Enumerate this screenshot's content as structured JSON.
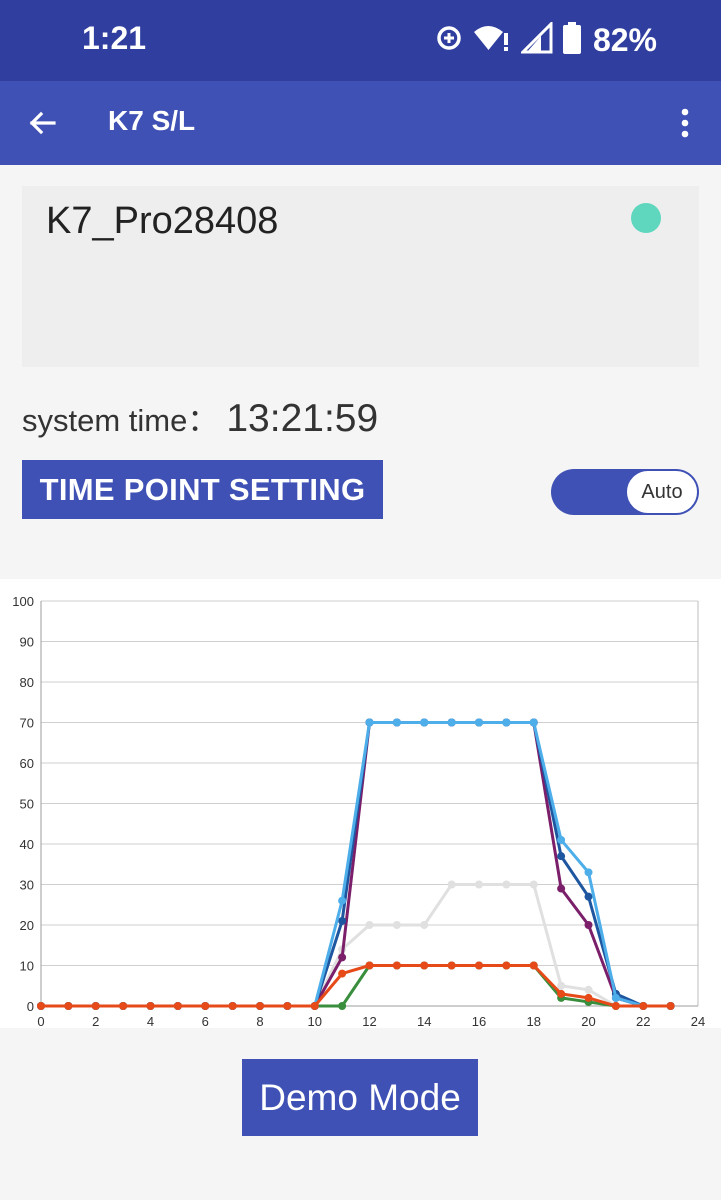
{
  "status_bar": {
    "time": "1:21",
    "battery": "82%",
    "icons": [
      "data-saver-icon",
      "wifi-alert-icon",
      "cell-signal-icon",
      "battery-icon"
    ]
  },
  "app_bar": {
    "title": "K7 S/L",
    "back_icon": "arrow-back-icon",
    "menu_icon": "more-vert-icon"
  },
  "device": {
    "name": "K7_Pro28408",
    "status_color": "#5fd7bf"
  },
  "system_time": {
    "label": "system time：",
    "value": "13:21:59"
  },
  "time_point_button": "TIME POINT SETTING",
  "mode_toggle": {
    "label": "Auto",
    "on": true
  },
  "demo_button": "Demo Mode",
  "colors": {
    "primary": "#3f51b5",
    "primary_dark": "#303f9f",
    "accent": "#5fd7bf"
  },
  "chart_data": {
    "type": "line",
    "x": [
      0,
      1,
      2,
      3,
      4,
      5,
      6,
      7,
      8,
      9,
      10,
      11,
      12,
      13,
      14,
      15,
      16,
      17,
      18,
      19,
      20,
      21,
      22,
      23,
      24
    ],
    "x_ticks": [
      0,
      2,
      4,
      6,
      8,
      10,
      12,
      14,
      16,
      18,
      20,
      22,
      24
    ],
    "y_ticks": [
      0,
      10,
      20,
      30,
      40,
      50,
      60,
      70,
      80,
      90,
      100
    ],
    "xlim": [
      0,
      24
    ],
    "ylim": [
      0,
      100
    ],
    "grid": true,
    "series": [
      {
        "color": "#e0e0e0",
        "values": [
          0,
          0,
          0,
          0,
          0,
          0,
          0,
          0,
          0,
          0,
          0,
          14,
          20,
          20,
          20,
          30,
          30,
          30,
          30,
          5,
          4,
          0,
          0,
          0,
          0
        ]
      },
      {
        "color": "#388e3c",
        "values": [
          0,
          0,
          0,
          0,
          0,
          0,
          0,
          0,
          0,
          0,
          0,
          0,
          10,
          10,
          10,
          10,
          10,
          10,
          10,
          2,
          1,
          0,
          0,
          0,
          0
        ]
      },
      {
        "color": "#7b1f6a",
        "values": [
          0,
          0,
          0,
          0,
          0,
          0,
          0,
          0,
          0,
          0,
          0,
          12,
          70,
          70,
          70,
          70,
          70,
          70,
          70,
          29,
          20,
          2,
          0,
          0,
          0
        ]
      },
      {
        "color": "#1e56a0",
        "values": [
          0,
          0,
          0,
          0,
          0,
          0,
          0,
          0,
          0,
          0,
          0,
          21,
          70,
          70,
          70,
          70,
          70,
          70,
          70,
          37,
          27,
          3,
          0,
          0,
          0
        ]
      },
      {
        "color": "#4daeea",
        "values": [
          0,
          0,
          0,
          0,
          0,
          0,
          0,
          0,
          0,
          0,
          0,
          26,
          70,
          70,
          70,
          70,
          70,
          70,
          70,
          41,
          33,
          2,
          0,
          0,
          0
        ]
      },
      {
        "color": "#e64a19",
        "values": [
          0,
          0,
          0,
          0,
          0,
          0,
          0,
          0,
          0,
          0,
          0,
          8,
          10,
          10,
          10,
          10,
          10,
          10,
          10,
          3,
          2,
          0,
          0,
          0,
          0
        ]
      }
    ]
  }
}
